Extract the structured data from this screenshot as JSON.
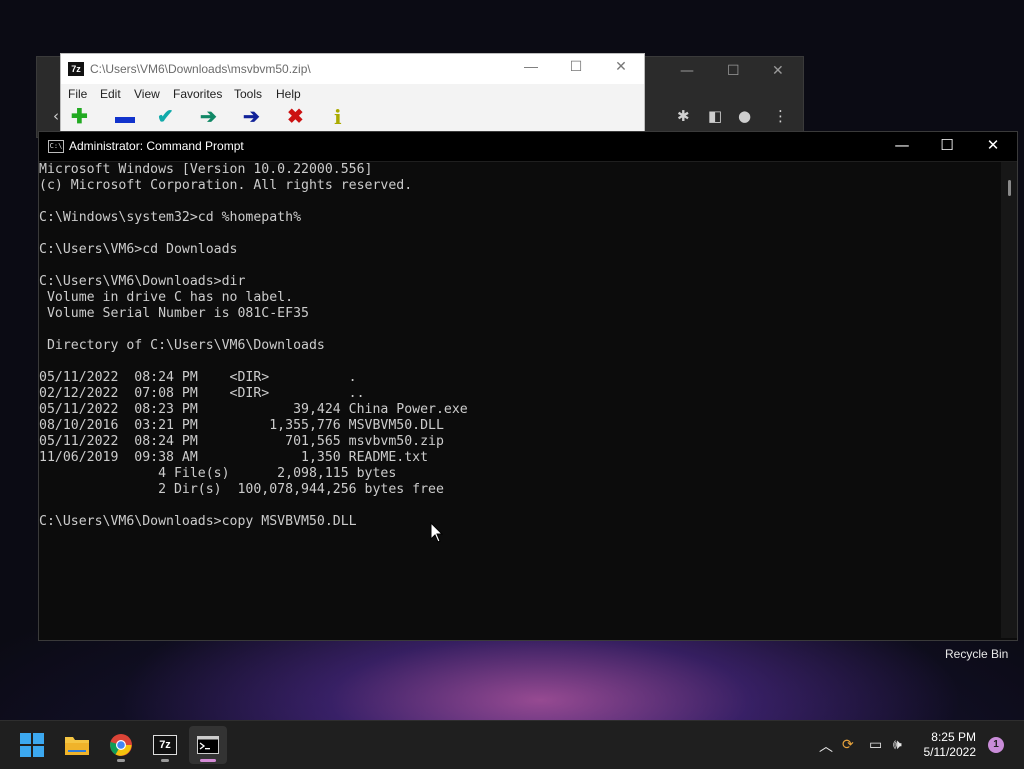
{
  "desktop": {
    "recycle_bin_label": "Recycle Bin"
  },
  "zip_window": {
    "app_icon_text": "7z",
    "title": "C:\\Users\\VM6\\Downloads\\msvbvm50.zip\\",
    "menu": [
      "File",
      "Edit",
      "View",
      "Favorites",
      "Tools",
      "Help"
    ],
    "toolbar_icons": [
      {
        "name": "add-icon",
        "glyph": "✚",
        "color": "#22aa22"
      },
      {
        "name": "extract-icon",
        "glyph": "▬",
        "color": "#1133cc"
      },
      {
        "name": "test-icon",
        "glyph": "✔",
        "color": "#11aaaa"
      },
      {
        "name": "copy-icon",
        "glyph": "➔",
        "color": "#118866"
      },
      {
        "name": "move-icon",
        "glyph": "➔",
        "color": "#112299"
      },
      {
        "name": "delete-icon",
        "glyph": "✖",
        "color": "#cc1111"
      },
      {
        "name": "info-icon",
        "glyph": "i",
        "color": "#aaaa00"
      }
    ]
  },
  "cmd_window": {
    "title": "Administrator: Command Prompt",
    "icon_text": "C:\\",
    "lines": [
      "Microsoft Windows [Version 10.0.22000.556]",
      "(c) Microsoft Corporation. All rights reserved.",
      "",
      "C:\\Windows\\system32>cd %homepath%",
      "",
      "C:\\Users\\VM6>cd Downloads",
      "",
      "C:\\Users\\VM6\\Downloads>dir",
      " Volume in drive C has no label.",
      " Volume Serial Number is 081C-EF35",
      "",
      " Directory of C:\\Users\\VM6\\Downloads",
      "",
      "05/11/2022  08:24 PM    <DIR>          .",
      "02/12/2022  07:08 PM    <DIR>          ..",
      "05/11/2022  08:23 PM            39,424 China Power.exe",
      "08/10/2016  03:21 PM         1,355,776 MSVBVM50.DLL",
      "05/11/2022  08:24 PM           701,565 msvbvm50.zip",
      "11/06/2019  09:38 AM             1,350 README.txt",
      "               4 File(s)      2,098,115 bytes",
      "               2 Dir(s)  100,078,944,256 bytes free",
      "",
      "C:\\Users\\VM6\\Downloads>copy MSVBVM50.DLL"
    ]
  },
  "taskbar": {
    "apps": [
      {
        "name": "start-button",
        "icon": "windows-icon"
      },
      {
        "name": "file-explorer-button",
        "icon": "folder-icon"
      },
      {
        "name": "chrome-button",
        "icon": "chrome-icon"
      },
      {
        "name": "7zip-button",
        "icon": "7zip-icon",
        "label": "7z"
      },
      {
        "name": "command-prompt-button",
        "icon": "cmd-icon"
      }
    ],
    "time": "8:25 PM",
    "date": "5/11/2022",
    "notification_count": "1"
  }
}
